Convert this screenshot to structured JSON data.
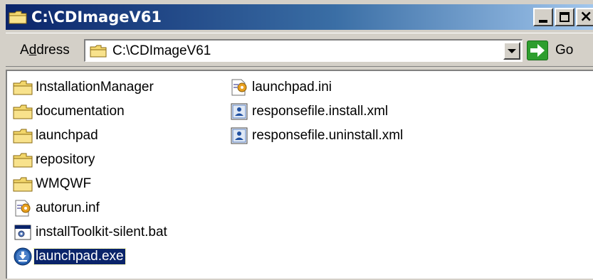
{
  "window": {
    "title": "C:\\CDImageV61",
    "controls": {
      "minimize": "_",
      "maximize": "□",
      "close": "×"
    }
  },
  "address_bar": {
    "label_underlined": "d",
    "label_prefix": "A",
    "label_suffix": "dress",
    "value": "C:\\CDImageV61",
    "go_label": "Go"
  },
  "files": {
    "column1": [
      {
        "name": "InstallationManager",
        "type": "folder"
      },
      {
        "name": "documentation",
        "type": "folder"
      },
      {
        "name": "launchpad",
        "type": "folder"
      },
      {
        "name": "repository",
        "type": "folder"
      },
      {
        "name": "WMQWF",
        "type": "folder"
      },
      {
        "name": "autorun.inf",
        "type": "ini"
      },
      {
        "name": "installToolkit-silent.bat",
        "type": "bat"
      },
      {
        "name": "launchpad.exe",
        "type": "exe",
        "selected": true
      }
    ],
    "column2": [
      {
        "name": "launchpad.ini",
        "type": "ini"
      },
      {
        "name": "responsefile.install.xml",
        "type": "xml"
      },
      {
        "name": "responsefile.uninstall.xml",
        "type": "xml"
      }
    ]
  },
  "colors": {
    "title_bar_start": "#0a246a",
    "title_bar_end": "#a6caf0",
    "folder_yellow": "#f2d66b",
    "selection": "#0a246a",
    "go_green": "#2e9e2e"
  }
}
